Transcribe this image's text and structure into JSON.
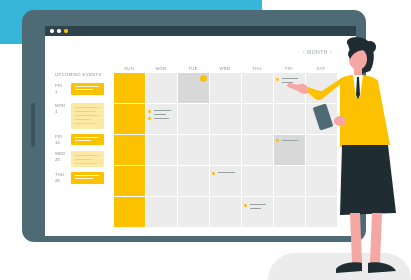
{
  "colors": {
    "accent_yellow": "#fcc201",
    "backdrop_blue": "#35b6d8",
    "tablet_frame": "#4e6a74",
    "cell_grey": "#ececec"
  },
  "calendar": {
    "month_nav": "‹  MONTH  ›",
    "day_names": [
      "SUN",
      "MON",
      "TUE",
      "WED",
      "THU",
      "FRI",
      "SAT"
    ]
  },
  "upcoming": {
    "title": "UPCOMING EVENTS",
    "events": [
      {
        "label": "FRI\n1"
      },
      {
        "label": "MON\n4"
      },
      {
        "label": "FRI\n15"
      },
      {
        "label": "WED\n20"
      },
      {
        "label": "THU\n26"
      }
    ]
  },
  "illustration": {
    "figure": "woman-pointing-icon",
    "holding": "tablet-device-icon"
  }
}
